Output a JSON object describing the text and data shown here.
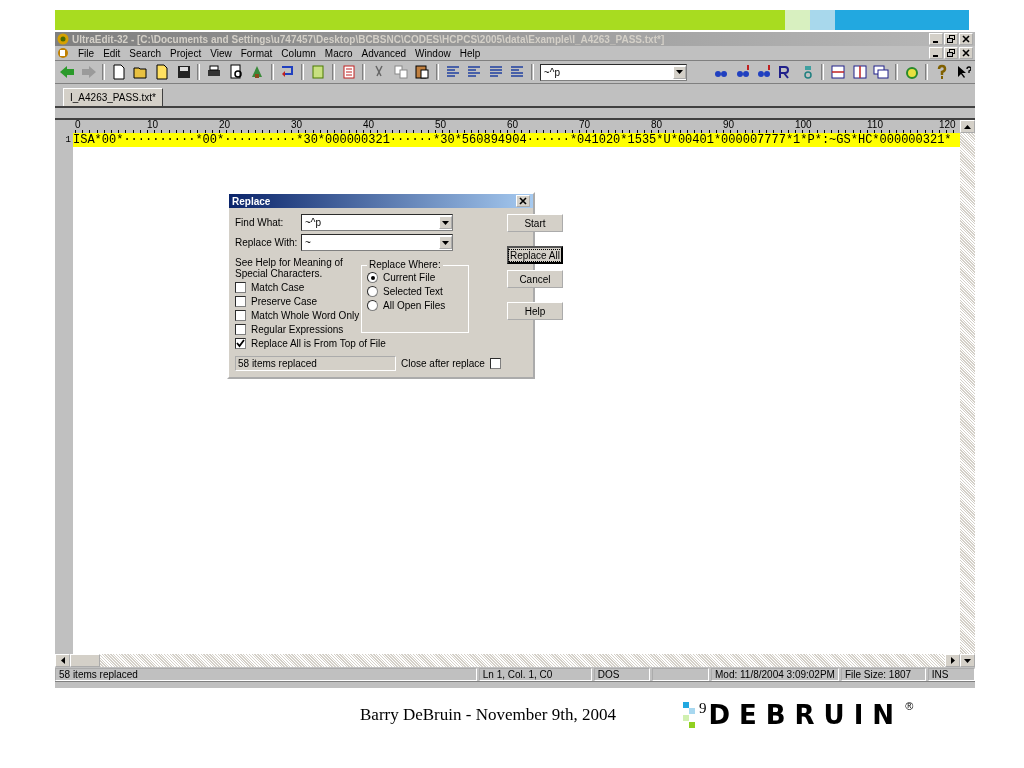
{
  "window": {
    "title": "UltraEdit-32 - [C:\\Documents and Settings\\u747457\\Desktop\\BCBSNC\\CODES\\HCPCS\\2005\\data\\Example\\I_A4263_PASS.txt*]",
    "active": false
  },
  "menu": [
    "File",
    "Edit",
    "Search",
    "Project",
    "View",
    "Format",
    "Column",
    "Macro",
    "Advanced",
    "Window",
    "Help"
  ],
  "toolbar": {
    "find_value": "~^p"
  },
  "tabs": [
    {
      "label": "I_A4263_PASS.txt*",
      "selected": true
    }
  ],
  "ruler": [
    "0",
    "10",
    "20",
    "30",
    "40",
    "50",
    "60",
    "70",
    "80",
    "90",
    "100",
    "110",
    "120"
  ],
  "lines": [
    {
      "number": "1",
      "text": "ISA*00*··········*00*··········*30*000000321······*30*560894904······*041020*1535*U*00401*000007777*1*P*:~GS*HC*000000321*",
      "highlighted": true
    }
  ],
  "dialog": {
    "title": "Replace",
    "find_what": {
      "label": "Find What:",
      "value": "~^p"
    },
    "replace_with": {
      "label": "Replace With:",
      "value": "~"
    },
    "help_note": "See Help for Meaning of Special Characters.",
    "options": [
      {
        "label": "Match Case",
        "checked": false
      },
      {
        "label": "Preserve Case",
        "checked": false
      },
      {
        "label": "Match Whole Word Only",
        "checked": false
      },
      {
        "label": "Regular Expressions",
        "checked": false
      },
      {
        "label": "Replace All is From Top of File",
        "checked": true
      }
    ],
    "replace_where": {
      "label": "Replace Where:",
      "choices": [
        {
          "label": "Current File",
          "selected": true
        },
        {
          "label": "Selected Text",
          "selected": false
        },
        {
          "label": "All Open Files",
          "selected": false
        }
      ]
    },
    "buttons": [
      {
        "label": "Start",
        "focused": false
      },
      {
        "label": "Replace All",
        "focused": true
      },
      {
        "label": "Cancel",
        "focused": false
      },
      {
        "label": "Help",
        "focused": false
      }
    ],
    "message": "58 items replaced",
    "close_after_replace": {
      "label": "Close after replace",
      "checked": false
    }
  },
  "status_bar": [
    "58 items replaced",
    "Ln 1, Col. 1, C0",
    "DOS",
    "Mod: 11/8/2004 3:09:02PM",
    "File Size: 1807",
    "INS"
  ],
  "footer": {
    "text": "Barry DeBruin - November 9th, 2004",
    "page_number": "9",
    "logo": "DEBRUIN",
    "registered": "®"
  }
}
